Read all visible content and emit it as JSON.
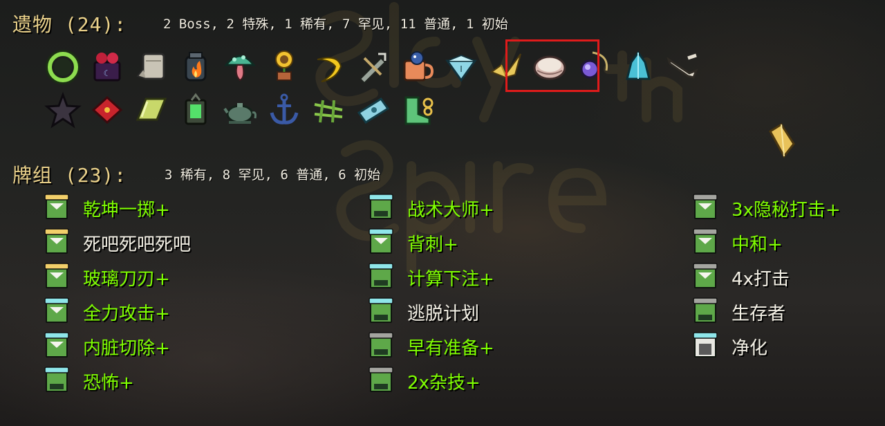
{
  "relics": {
    "title": "遗物 (24):",
    "summary": "2 Boss, 2 特殊, 1 稀有, 7 罕见, 11 普通, 1 初始",
    "row1": [
      "ring-icon",
      "cursed-box-icon",
      "bandage-icon",
      "fire-jar-icon",
      "mushroom-icon",
      "sunflower-icon",
      "banana-icon",
      "shuriken-icon",
      "mug-icon",
      "prism-icon",
      "paper-crane-icon",
      "clam-shell-icon",
      "pendant-icon",
      "crystal-icon",
      "bone-icon"
    ],
    "row2": [
      "star-icon",
      "cushion-icon",
      "gold-bar-icon",
      "lantern-icon",
      "teapot-icon",
      "anchor-icon",
      "chopsticks-icon",
      "ticket-icon",
      "boot-icon"
    ]
  },
  "deck": {
    "title": "牌组 (23):",
    "summary": "3 稀有, 8 罕见, 6 普通, 6 初始",
    "col1": [
      {
        "name": "乾坤一掷+",
        "upgraded": true,
        "rarity": "rare",
        "type": "skill"
      },
      {
        "name": "死吧死吧死吧",
        "upgraded": false,
        "rarity": "rare",
        "type": "skill"
      },
      {
        "name": "玻璃刀刃+",
        "upgraded": true,
        "rarity": "rare",
        "type": "skill"
      },
      {
        "name": "全力攻击+",
        "upgraded": true,
        "rarity": "uncommon",
        "type": "skill"
      },
      {
        "name": "内脏切除+",
        "upgraded": true,
        "rarity": "uncommon",
        "type": "skill"
      },
      {
        "name": "恐怖+",
        "upgraded": true,
        "rarity": "uncommon",
        "type": "attack"
      }
    ],
    "col2": [
      {
        "name": "战术大师+",
        "upgraded": true,
        "rarity": "uncommon",
        "type": "attack"
      },
      {
        "name": "背刺+",
        "upgraded": true,
        "rarity": "uncommon",
        "type": "skill"
      },
      {
        "name": "计算下注+",
        "upgraded": true,
        "rarity": "uncommon",
        "type": "attack"
      },
      {
        "name": "逃脱计划",
        "upgraded": false,
        "rarity": "uncommon",
        "type": "attack"
      },
      {
        "name": "早有准备+",
        "upgraded": true,
        "rarity": "common",
        "type": "attack"
      },
      {
        "name": "2x杂技+",
        "upgraded": true,
        "rarity": "common",
        "type": "attack"
      }
    ],
    "col3": [
      {
        "name": "3x隐秘打击+",
        "upgraded": true,
        "rarity": "common",
        "type": "skill"
      },
      {
        "name": "中和+",
        "upgraded": true,
        "rarity": "common",
        "type": "skill"
      },
      {
        "name": "4x打击",
        "upgraded": false,
        "rarity": "common",
        "type": "skill"
      },
      {
        "name": "生存者",
        "upgraded": false,
        "rarity": "common",
        "type": "attack"
      },
      {
        "name": "净化",
        "upgraded": false,
        "rarity": "uncommon",
        "type": "power"
      }
    ]
  },
  "colors": {
    "title": "#ead18a",
    "upgraded": "#7fff00",
    "base": "#f4f1e6",
    "highlight": "#e01b1b",
    "rare_cap": "#f2cf6a",
    "uncommon_cap": "#8fe6ea",
    "common_cap": "#a5a5a0",
    "body_green": "#5ea849",
    "body_dark": "#1f3b22"
  }
}
